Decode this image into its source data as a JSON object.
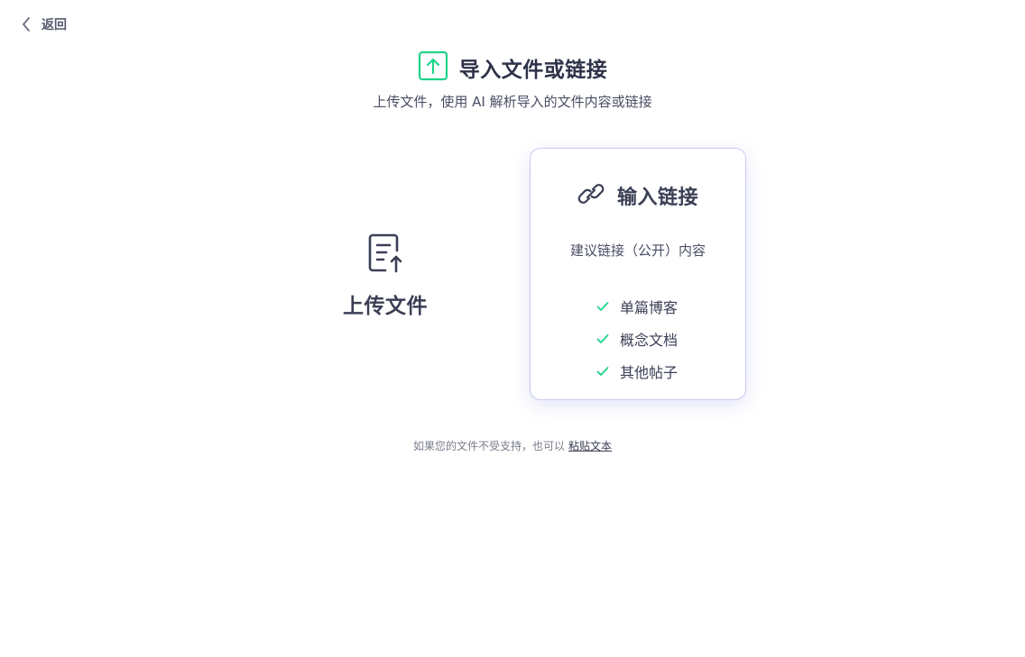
{
  "nav": {
    "back_label": "返回"
  },
  "header": {
    "title": "导入文件或链接",
    "subtitle": "上传文件，使用 AI 解析导入的文件内容或链接",
    "accent_color": "#1fd38b"
  },
  "upload": {
    "label": "上传文件",
    "icon": "file-upload-icon"
  },
  "link_card": {
    "title": "输入链接",
    "icon": "link-icon",
    "description": "建议链接（公开）内容",
    "items": [
      "单篇博客",
      "概念文档",
      "其他帖子"
    ],
    "check_color": "#1fd38b",
    "border_color": "#c9cbf2"
  },
  "footer": {
    "text": "如果您的文件不受支持，也可以",
    "paste_link": "粘贴文本"
  }
}
